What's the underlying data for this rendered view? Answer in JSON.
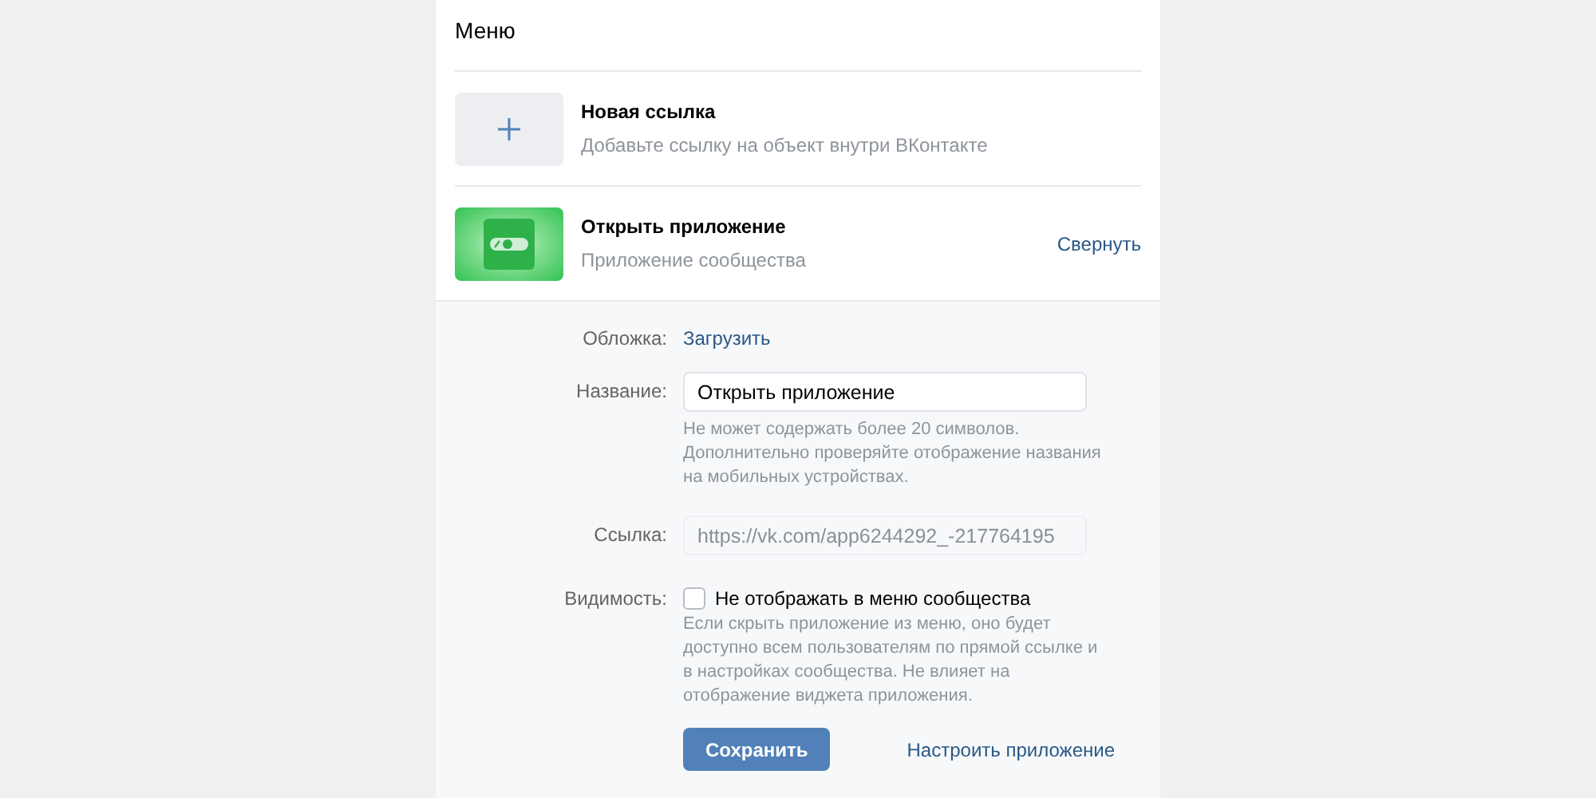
{
  "header": {
    "title": "Меню"
  },
  "menu_items": [
    {
      "kind": "add",
      "title": "Новая ссылка",
      "subtitle": "Добавьте ссылку на объект внутри ВКонтакте"
    },
    {
      "kind": "app",
      "title": "Открыть приложение",
      "subtitle": "Приложение сообщества",
      "action": "Свернуть"
    }
  ],
  "form": {
    "cover": {
      "label": "Обложка:",
      "link": "Загрузить"
    },
    "name": {
      "label": "Название:",
      "value": "Открыть приложение",
      "hint": "Не может содержать более 20 символов. Дополнительно проверяйте отображение названия на мобильных устройствах."
    },
    "link": {
      "label": "Ссылка:",
      "placeholder": "https://vk.com/app6244292_-217764195",
      "disabled": true
    },
    "visibility": {
      "label": "Видимость:",
      "checkbox_label": "Не отображать в меню сообщества",
      "checked": false,
      "hint": "Если скрыть приложение из меню, оно будет доступно всем пользователям по прямой ссылке и в настройках сообщества. Не влияет на отображение виджета приложения."
    },
    "buttons": {
      "save": "Сохранить",
      "configure": "Настроить приложение"
    }
  }
}
